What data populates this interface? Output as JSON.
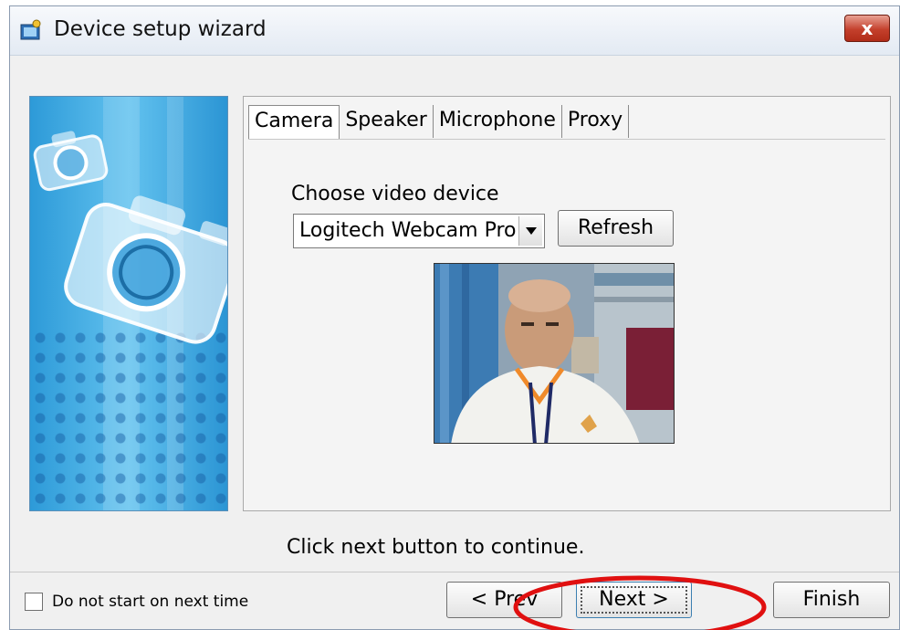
{
  "window": {
    "title": "Device setup wizard",
    "close_glyph": "x"
  },
  "tabs": [
    {
      "label": "Camera",
      "active": true
    },
    {
      "label": "Speaker",
      "active": false
    },
    {
      "label": "Microphone",
      "active": false
    },
    {
      "label": "Proxy",
      "active": false
    }
  ],
  "camera": {
    "field_label": "Choose video device",
    "device_value": "Logitech Webcam Pro",
    "refresh_label": "Refresh"
  },
  "footer": {
    "hint": "Click next button to continue.",
    "checkbox_label": "Do not start on next time",
    "checkbox_checked": false,
    "prev_label": "< Prev",
    "next_label": "Next >",
    "finish_label": "Finish"
  },
  "colors": {
    "annotation_ellipse": "#e01010",
    "banner_blue": "#3aa6e0",
    "close_red": "#c4402c"
  },
  "icons": {
    "title": "wizard-app-icon",
    "banner": "camera-icon",
    "dropdown": "chevron-down-icon"
  }
}
